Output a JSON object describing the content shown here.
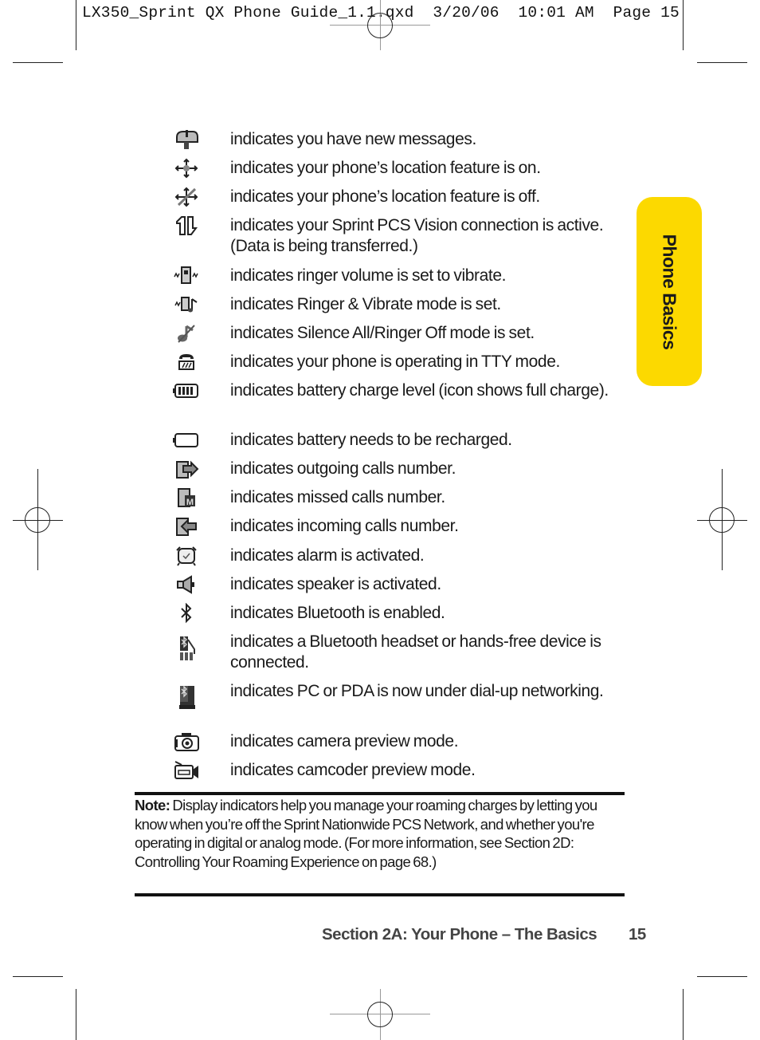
{
  "slug": {
    "filename": "LX350_Sprint QX Phone Guide_1.1.qxd",
    "date": "3/20/06",
    "time": "10:01 AM",
    "page_label": "Page 15"
  },
  "side_tab": {
    "label": "Phone Basics",
    "color": "#fcd900"
  },
  "indicators": [
    {
      "icon": "new-messages-mailbox-icon",
      "text": "indicates you have new messages."
    },
    {
      "icon": "location-on-icon",
      "text": "indicates your phone’s location feature is on."
    },
    {
      "icon": "location-off-icon",
      "text": "indicates your phone’s location feature is off."
    },
    {
      "icon": "vision-data-transfer-icon",
      "text": "indicates your Sprint PCS Vision connection is active. (Data is being transferred.)"
    },
    {
      "icon": "vibrate-icon",
      "text": "indicates ringer volume is set to vibrate."
    },
    {
      "icon": "ringer-and-vibrate-icon",
      "text": "indicates Ringer & Vibrate mode is set."
    },
    {
      "icon": "silence-all-icon",
      "text": "indicates Silence All/Ringer Off mode is set."
    },
    {
      "icon": "tty-icon",
      "text": "indicates your phone is operating in TTY mode."
    },
    {
      "icon": "battery-full-icon",
      "text": "indicates battery charge level (icon shows full charge)."
    },
    {
      "icon": "battery-empty-icon",
      "text": "indicates battery needs to be recharged."
    },
    {
      "icon": "outgoing-calls-icon",
      "text": "indicates outgoing calls number."
    },
    {
      "icon": "missed-calls-icon",
      "text": "indicates missed calls number."
    },
    {
      "icon": "incoming-calls-icon",
      "text": "indicates incoming calls number."
    },
    {
      "icon": "alarm-clock-icon",
      "text": "indicates alarm is activated."
    },
    {
      "icon": "speaker-icon",
      "text": "indicates speaker is activated."
    },
    {
      "icon": "bluetooth-icon",
      "text": "indicates Bluetooth is enabled."
    },
    {
      "icon": "bluetooth-headset-connected-icon",
      "text": "indicates a Bluetooth headset or hands-free device is connected."
    },
    {
      "icon": "bluetooth-dialup-networking-icon",
      "text": "indicates PC or PDA is now under dial-up networking."
    },
    {
      "icon": "camera-icon",
      "text": "indicates camera preview mode."
    },
    {
      "icon": "camcorder-icon",
      "text": "indicates camcoder preview mode."
    }
  ],
  "note": {
    "label": "Note:",
    "text": "Display indicators help you manage your roaming charges by letting you know when you’re off the Sprint Nationwide PCS Network, and whether you're operating in digital or analog mode. (For more information, see Section 2D: Controlling Your Roaming Experience on page 68.)"
  },
  "footer": {
    "section": "Section 2A: Your Phone – The Basics",
    "page_number": "15"
  }
}
